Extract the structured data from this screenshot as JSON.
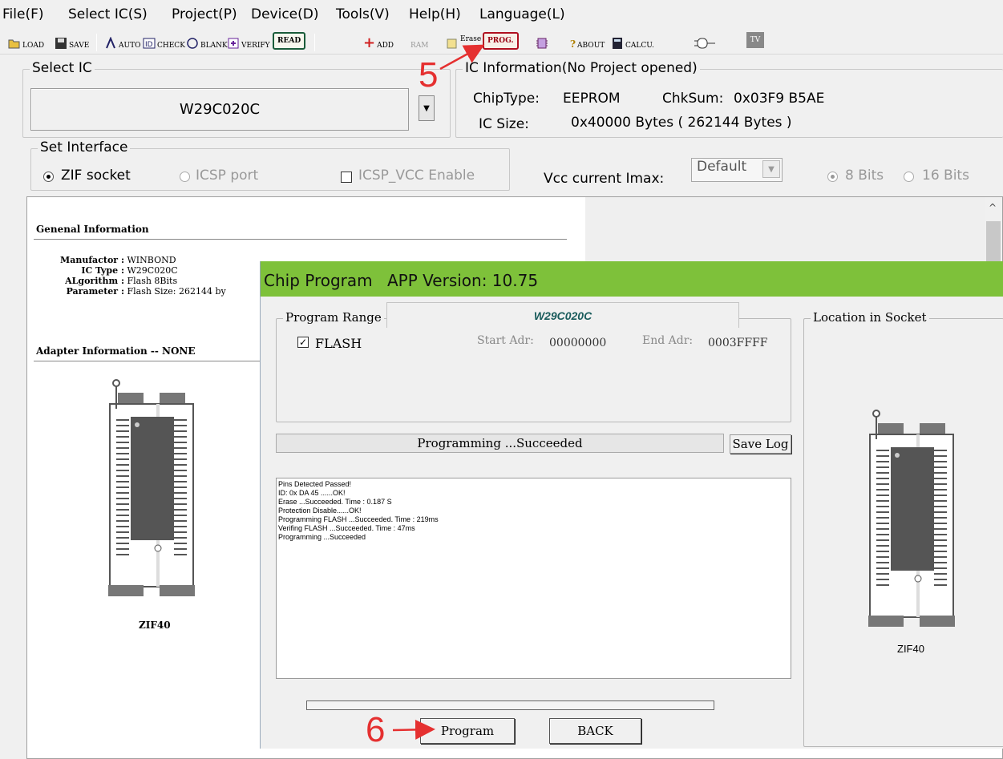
{
  "menu": [
    "File(F)",
    "Select IC(S)",
    "Project(P)",
    "Device(D)",
    "Tools(V)",
    "Help(H)",
    "Language(L)"
  ],
  "toolbar": {
    "load": "LOAD",
    "save": "SAVE",
    "auto": "AUTO",
    "check": "CHECK",
    "blank": "BLANK",
    "verify": "VERIFY",
    "read": "READ",
    "add": "ADD",
    "ram": "RAM",
    "erase": "Erase",
    "prog": "PROG.",
    "about": "ABOUT",
    "calcu": "CALCU.",
    "tv": "TV"
  },
  "select_ic": {
    "title": "Select IC",
    "value": "W29C020C"
  },
  "ic_info": {
    "title": "IC Information(No Project opened)",
    "chip_type_label": "ChipType:",
    "chip_type": "EEPROM",
    "chksum_label": "ChkSum:",
    "chksum": "0x03F9 B5AE",
    "size_label": "IC Size:",
    "size": "0x40000 Bytes ( 262144 Bytes )"
  },
  "interface": {
    "title": "Set Interface",
    "zif": "ZIF socket",
    "icsp": "ICSP port",
    "icsp_vcc": "ICSP_VCC Enable",
    "vcc_label": "Vcc current Imax:",
    "vcc_value": "Default",
    "bits8": "8 Bits",
    "bits16": "16 Bits"
  },
  "general": {
    "heading": "Genenal Information",
    "rows": [
      {
        "k": "Manufactor",
        "v": "WINBOND"
      },
      {
        "k": "IC Type",
        "v": "W29C020C"
      },
      {
        "k": "ALgorithm",
        "v": "Flash 8Bits"
      },
      {
        "k": "Parameter",
        "v": "Flash Size: 262144 by"
      }
    ],
    "adapter": "Adapter Information -- NONE",
    "socket": "ZIF40"
  },
  "dialog": {
    "title": "Chip Program",
    "version": "APP Version: 10.75",
    "range_title": "Program Range",
    "chip": "W29C020C",
    "flash": "FLASH",
    "start_label": "Start Adr:",
    "start": "00000000",
    "end_label": "End Adr:",
    "end": "0003FFFF",
    "status": "Programming ...Succeeded",
    "save_log": "Save Log",
    "log": [
      "Pins Detected Passed!",
      "ID: 0x DA 45 ......OK!",
      "Erase  ...Succeeded. Time : 0.187 S",
      "Protection Disable......OK!",
      "Programming FLASH ...Succeeded. Time : 219ms",
      "Verifing FLASH ...Succeeded. Time : 47ms",
      "Programming  ...Succeeded"
    ],
    "program_btn": "Program",
    "back_btn": "BACK",
    "location_title": "Location in Socket",
    "socket": "ZIF40"
  },
  "annotations": {
    "step5": "5",
    "step6": "6"
  },
  "colors": {
    "dialog_title": "#7ec13a",
    "annotation": "#e53030",
    "chip_name": "#1a5c5c"
  }
}
